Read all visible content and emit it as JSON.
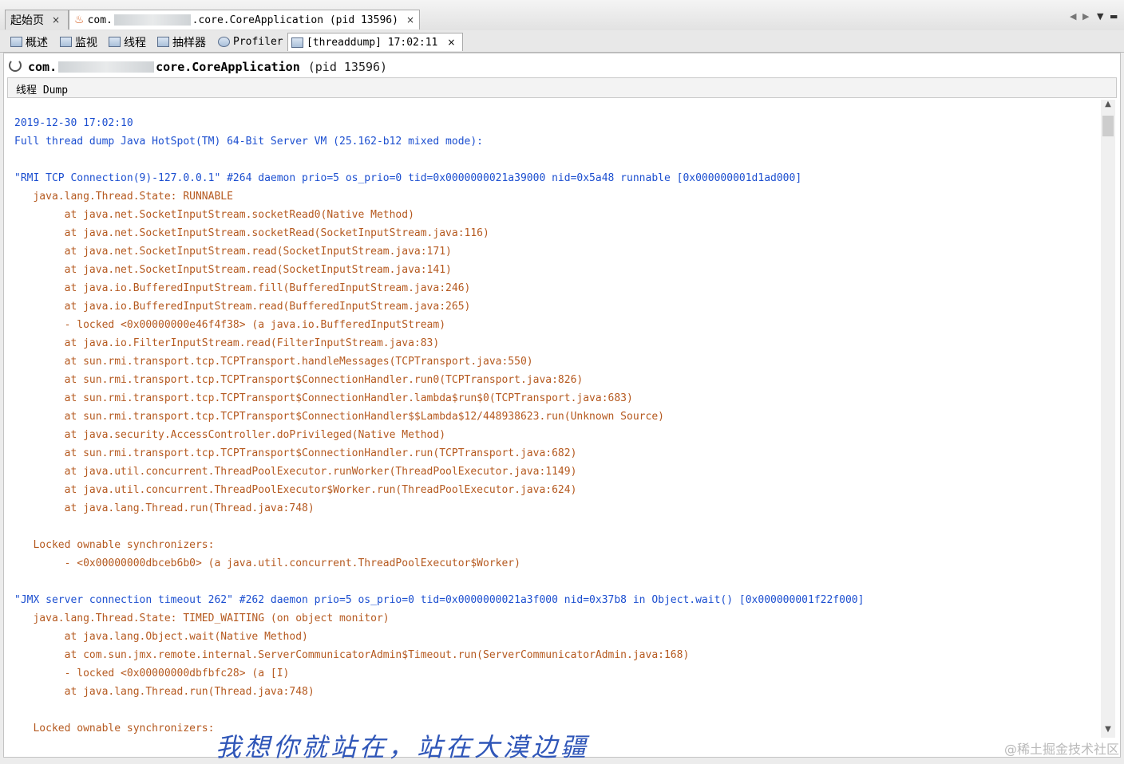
{
  "editor_tabs": [
    {
      "label": "起始页",
      "close": "×"
    },
    {
      "label_prefix": "com.",
      "label_suffix": ".core.CoreApplication (pid 13596)",
      "close": "×"
    }
  ],
  "view_tabs": [
    {
      "label": "概述"
    },
    {
      "label": "监视"
    },
    {
      "label": "线程"
    },
    {
      "label": "抽样器"
    },
    {
      "label": "Profiler"
    },
    {
      "label": "[threaddump] 17:02:11",
      "close": "×"
    }
  ],
  "app_header": {
    "prefix": "com.",
    "main": "core.CoreApplication",
    "pid": "(pid 13596)"
  },
  "dump_title": "线程 Dump",
  "dump_lines": [
    {
      "text": "2019-12-30 17:02:10",
      "color": "blue"
    },
    {
      "text": "Full thread dump Java HotSpot(TM) 64-Bit Server VM (25.162-b12 mixed mode):",
      "color": "blue"
    },
    {
      "text": "",
      "color": "blue"
    },
    {
      "text": "\"RMI TCP Connection(9)-127.0.0.1\" #264 daemon prio=5 os_prio=0 tid=0x0000000021a39000 nid=0x5a48 runnable [0x000000001d1ad000]",
      "color": "blue"
    },
    {
      "text": "   java.lang.Thread.State: RUNNABLE",
      "color": "orange"
    },
    {
      "text": "        at java.net.SocketInputStream.socketRead0(Native Method)",
      "color": "orange"
    },
    {
      "text": "        at java.net.SocketInputStream.socketRead(SocketInputStream.java:116)",
      "color": "orange"
    },
    {
      "text": "        at java.net.SocketInputStream.read(SocketInputStream.java:171)",
      "color": "orange"
    },
    {
      "text": "        at java.net.SocketInputStream.read(SocketInputStream.java:141)",
      "color": "orange"
    },
    {
      "text": "        at java.io.BufferedInputStream.fill(BufferedInputStream.java:246)",
      "color": "orange"
    },
    {
      "text": "        at java.io.BufferedInputStream.read(BufferedInputStream.java:265)",
      "color": "orange"
    },
    {
      "text": "        - locked <0x00000000e46f4f38> (a java.io.BufferedInputStream)",
      "color": "orange"
    },
    {
      "text": "        at java.io.FilterInputStream.read(FilterInputStream.java:83)",
      "color": "orange"
    },
    {
      "text": "        at sun.rmi.transport.tcp.TCPTransport.handleMessages(TCPTransport.java:550)",
      "color": "orange"
    },
    {
      "text": "        at sun.rmi.transport.tcp.TCPTransport$ConnectionHandler.run0(TCPTransport.java:826)",
      "color": "orange"
    },
    {
      "text": "        at sun.rmi.transport.tcp.TCPTransport$ConnectionHandler.lambda$run$0(TCPTransport.java:683)",
      "color": "orange"
    },
    {
      "text": "        at sun.rmi.transport.tcp.TCPTransport$ConnectionHandler$$Lambda$12/448938623.run(Unknown Source)",
      "color": "orange"
    },
    {
      "text": "        at java.security.AccessController.doPrivileged(Native Method)",
      "color": "orange"
    },
    {
      "text": "        at sun.rmi.transport.tcp.TCPTransport$ConnectionHandler.run(TCPTransport.java:682)",
      "color": "orange"
    },
    {
      "text": "        at java.util.concurrent.ThreadPoolExecutor.runWorker(ThreadPoolExecutor.java:1149)",
      "color": "orange"
    },
    {
      "text": "        at java.util.concurrent.ThreadPoolExecutor$Worker.run(ThreadPoolExecutor.java:624)",
      "color": "orange"
    },
    {
      "text": "        at java.lang.Thread.run(Thread.java:748)",
      "color": "orange"
    },
    {
      "text": "",
      "color": "orange"
    },
    {
      "text": "   Locked ownable synchronizers:",
      "color": "orange"
    },
    {
      "text": "        - <0x00000000dbceb6b0> (a java.util.concurrent.ThreadPoolExecutor$Worker)",
      "color": "orange"
    },
    {
      "text": "",
      "color": "orange"
    },
    {
      "text": "\"JMX server connection timeout 262\" #262 daemon prio=5 os_prio=0 tid=0x0000000021a3f000 nid=0x37b8 in Object.wait() [0x000000001f22f000]",
      "color": "blue"
    },
    {
      "text": "   java.lang.Thread.State: TIMED_WAITING (on object monitor)",
      "color": "orange"
    },
    {
      "text": "        at java.lang.Object.wait(Native Method)",
      "color": "orange"
    },
    {
      "text": "        at com.sun.jmx.remote.internal.ServerCommunicatorAdmin$Timeout.run(ServerCommunicatorAdmin.java:168)",
      "color": "orange"
    },
    {
      "text": "        - locked <0x00000000dbfbfc28> (a [I)",
      "color": "orange"
    },
    {
      "text": "        at java.lang.Thread.run(Thread.java:748)",
      "color": "orange"
    },
    {
      "text": "",
      "color": "orange"
    },
    {
      "text": "   Locked ownable synchronizers:",
      "color": "orange"
    }
  ],
  "watermark": "我想你就站在，站在大漠边疆",
  "watermark_site": "@稀土掘金技术社区"
}
